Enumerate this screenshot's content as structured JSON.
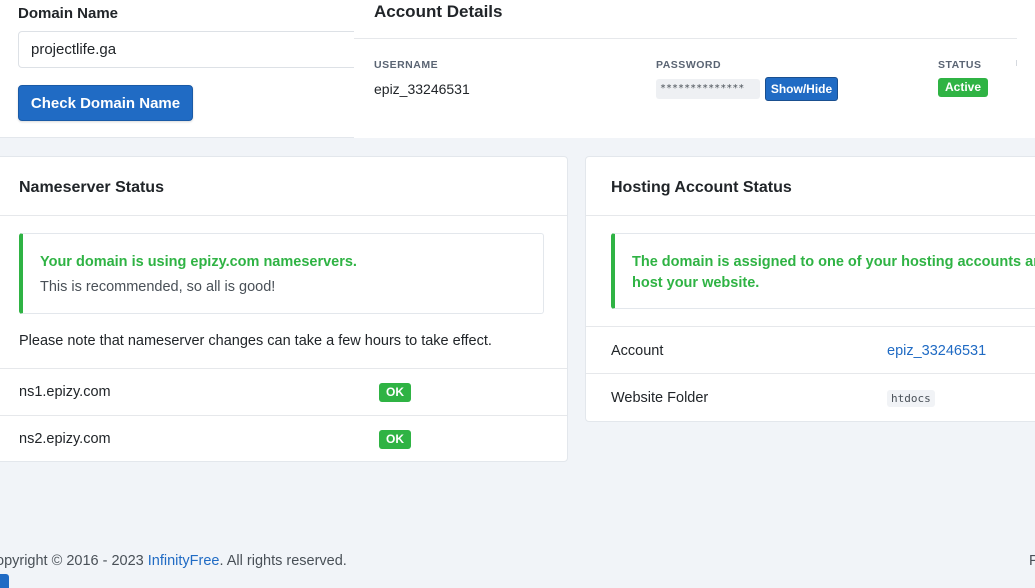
{
  "domain_form": {
    "label": "Domain Name",
    "input_value": "projectlife.ga",
    "check_button": "Check Domain Name"
  },
  "account_details": {
    "title": "Account Details",
    "username_header": "USERNAME",
    "username": "epiz_33246531",
    "password_header": "PASSWORD",
    "password_mask": "**************",
    "show_hide_button": "Show/Hide",
    "status_header": "STATUS",
    "status": "Active"
  },
  "nameserver_status": {
    "title": "Nameserver Status",
    "alert_title": "Your domain is using epizy.com nameservers.",
    "alert_text": "This is recommended, so all is good!",
    "note": "Please note that nameserver changes can take a few hours to take effect.",
    "servers": [
      {
        "name": "ns1.epizy.com",
        "status": "OK"
      },
      {
        "name": "ns2.epizy.com",
        "status": "OK"
      }
    ]
  },
  "hosting_status": {
    "title": "Hosting Account Status",
    "alert_line1": "The domain is assigned to one of your hosting accounts and",
    "alert_line2": "host your website.",
    "rows": [
      {
        "label": "Account",
        "value": "epiz_33246531"
      },
      {
        "label": "Website Folder",
        "value": "htdocs"
      }
    ]
  },
  "footer": {
    "copyright_prefix": "opyright © 2016 - 2023 ",
    "brand": "InfinityFree",
    "suffix": ". All rights reserved.",
    "right_fragment": "P"
  },
  "colors": {
    "primary": "#206bc4",
    "success": "#2fb344",
    "background": "#f1f4f8"
  }
}
